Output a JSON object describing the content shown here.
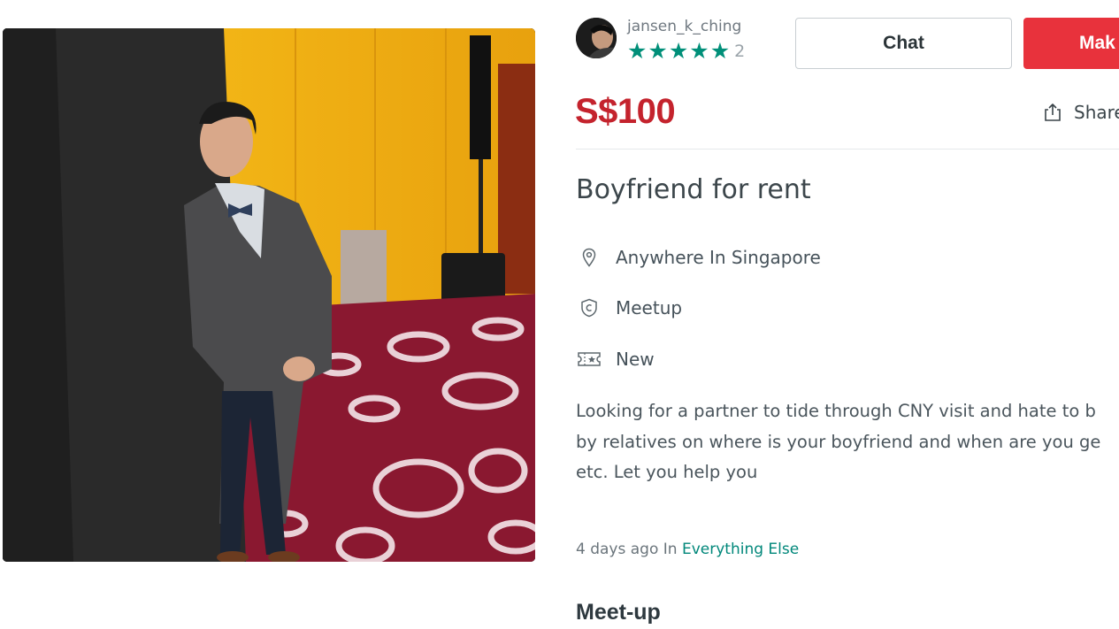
{
  "seller": {
    "username": "jansen_k_ching",
    "rating_stars": 5,
    "review_count": "2",
    "star_glyph": "★"
  },
  "actions": {
    "chat_label": "Chat",
    "offer_label": "Mak"
  },
  "listing": {
    "price": "S$100",
    "share_label": "Share",
    "title": "Boyfriend for rent",
    "location": "Anywhere In Singapore",
    "deal_method": "Meetup",
    "condition": "New",
    "description_lines": [
      "Looking for a partner to tide through CNY visit and hate to b",
      "by relatives on where is your boyfriend and when are you ge",
      "etc. Let you help you"
    ],
    "posted": "4 days ago In ",
    "category": "Everything Else",
    "section_heading": "Meet-up"
  },
  "colors": {
    "price_red": "#c4232d",
    "offer_button": "#e8323c",
    "rating_green": "#008f79",
    "link_green": "#00877a"
  },
  "icons": {
    "location": "map-pin-icon",
    "deal_method": "meetup-badge-icon",
    "condition": "new-ticket-icon",
    "share": "share-icon"
  }
}
